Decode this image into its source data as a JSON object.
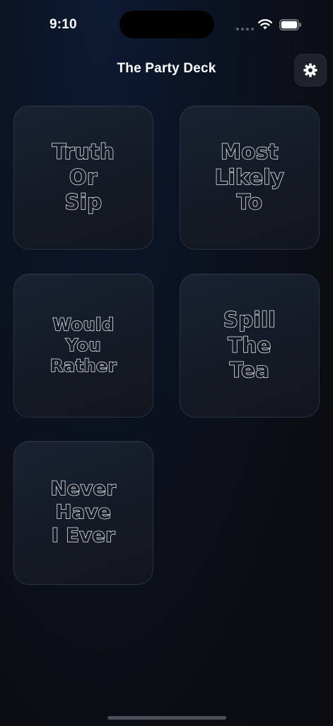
{
  "status_bar": {
    "time": "9:10",
    "icons": [
      "signal-dots-icon",
      "wifi-icon",
      "battery-icon"
    ]
  },
  "header": {
    "title": "The Party Deck",
    "settings_icon": "gear-icon"
  },
  "games": [
    {
      "label": "Truth\nOr\nSip"
    },
    {
      "label": "Most\nLikely\nTo"
    },
    {
      "label": "Would\nYou\nRather"
    },
    {
      "label": "Spill\nThe\nTea"
    },
    {
      "label": "Never\nHave\nI Ever"
    }
  ],
  "colors": {
    "background": "#0b0d12",
    "card_background": "#161c27",
    "card_border": "#2a3140",
    "text": "#ffffff",
    "label_outline": "#e8ecf2"
  }
}
